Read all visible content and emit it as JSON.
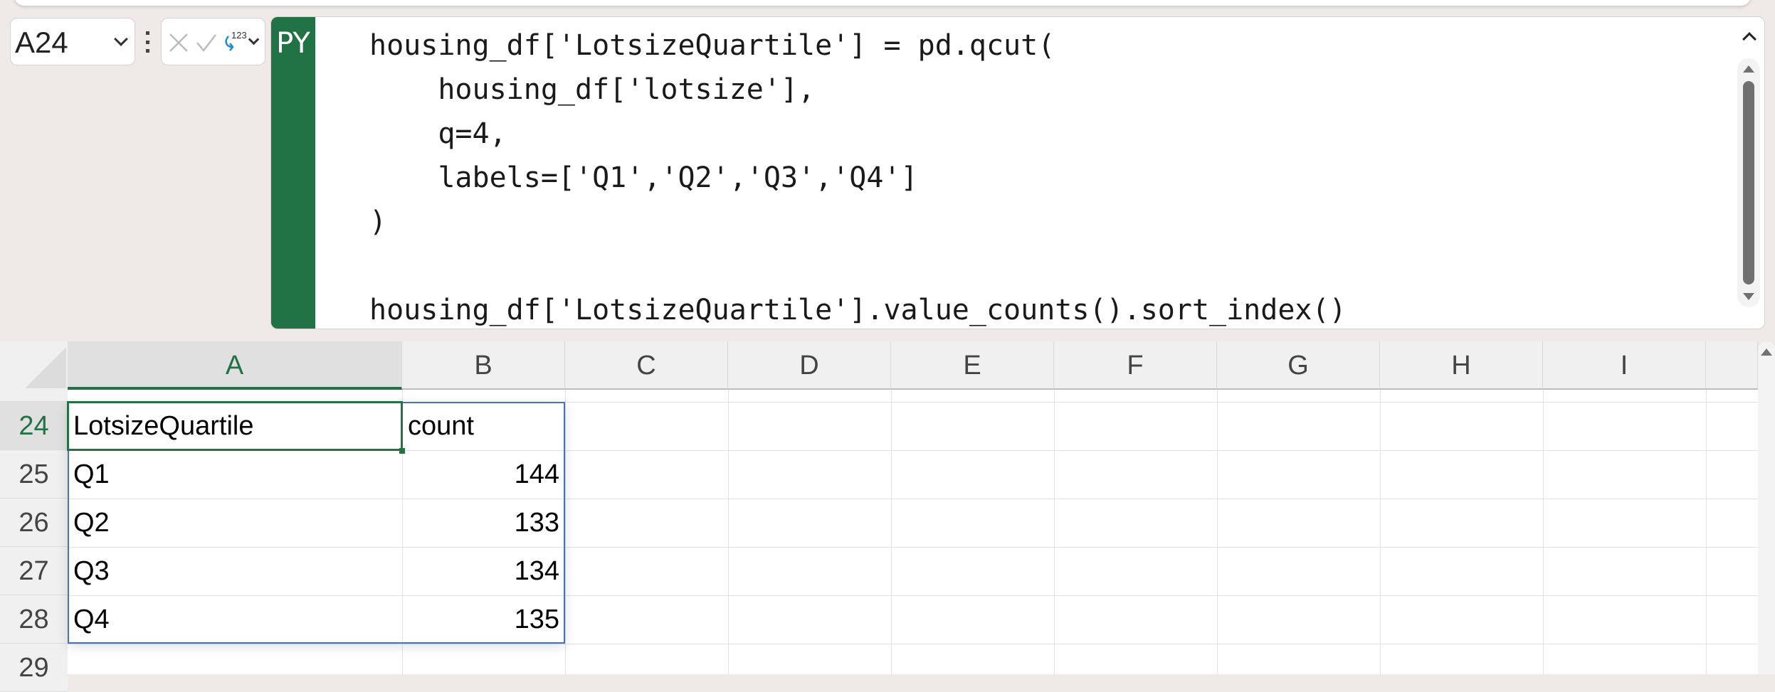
{
  "name_box": {
    "value": "A24"
  },
  "formula_bar": {
    "mode_badge": "PY",
    "output_type_label": "123",
    "code_lines": [
      "housing_df['LotsizeQuartile'] = pd.qcut(",
      "    housing_df['lotsize'],",
      "    q=4,",
      "    labels=['Q1','Q2','Q3','Q4']",
      ")",
      "",
      "housing_df['LotsizeQuartile'].value_counts().sort_index()"
    ]
  },
  "grid": {
    "columns": [
      "A",
      "B",
      "C",
      "D",
      "E",
      "F",
      "G",
      "H",
      "I"
    ],
    "selected_cell": "A24",
    "rows": [
      {
        "num": "24",
        "a": "LotsizeQuartile",
        "b": "count"
      },
      {
        "num": "25",
        "a": "Q1",
        "b": "144"
      },
      {
        "num": "26",
        "a": "Q2",
        "b": "133"
      },
      {
        "num": "27",
        "a": "Q3",
        "b": "134"
      },
      {
        "num": "28",
        "a": "Q4",
        "b": "135"
      },
      {
        "num": "29",
        "a": "",
        "b": ""
      }
    ]
  },
  "colors": {
    "accent": "#217346",
    "selection_border": "#4472c4"
  }
}
